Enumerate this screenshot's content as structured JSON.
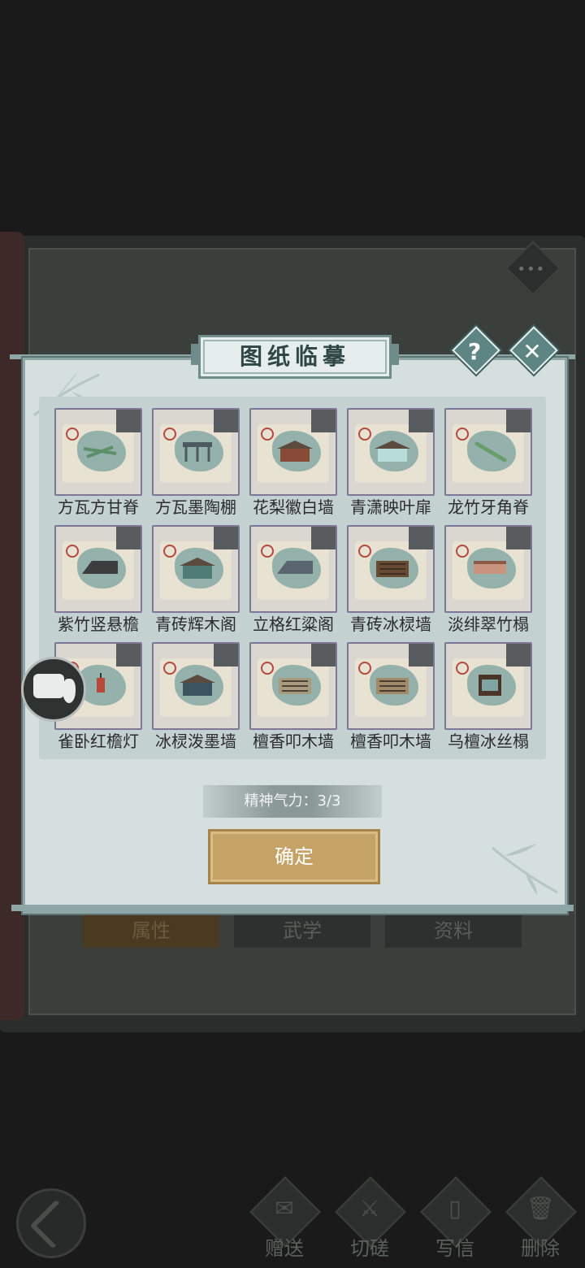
{
  "background": {
    "tabs": [
      "属性",
      "武学",
      "资料"
    ],
    "bottom_actions": [
      {
        "label": "赠送",
        "icon": "scroll-icon"
      },
      {
        "label": "切磋",
        "icon": "sword-icon"
      },
      {
        "label": "写信",
        "icon": "letter-icon"
      },
      {
        "label": "删除",
        "icon": "trash-icon"
      }
    ],
    "more_label": "•••"
  },
  "dialog": {
    "title": "图纸临摹",
    "help_label": "?",
    "close_label": "✕",
    "items": [
      {
        "name": "方瓦方甘脊",
        "color": "#5c8f6a",
        "shape": "beam"
      },
      {
        "name": "方瓦墨陶棚",
        "color": "#4d5a60",
        "shape": "pavilion"
      },
      {
        "name": "花梨徽白墙",
        "color": "#8a4a38",
        "shape": "house"
      },
      {
        "name": "青潇映叶扉",
        "color": "#b8ddd8",
        "shape": "house"
      },
      {
        "name": "龙竹牙角脊",
        "color": "#6a9d6e",
        "shape": "stick"
      },
      {
        "name": "紫竹竖悬檐",
        "color": "#3d3d3d",
        "shape": "roof"
      },
      {
        "name": "青砖辉木阁",
        "color": "#4f7c74",
        "shape": "house"
      },
      {
        "name": "立格红粱阁",
        "color": "#5b6570",
        "shape": "roof"
      },
      {
        "name": "青砖冰棂墙",
        "color": "#6a4a32",
        "shape": "wall"
      },
      {
        "name": "淡绯翠竹榻",
        "color": "#c9947d",
        "shape": "bed"
      },
      {
        "name": "雀卧红檐灯",
        "color": "#b8483a",
        "shape": "lamp"
      },
      {
        "name": "冰棂泼墨墙",
        "color": "#3a5560",
        "shape": "house"
      },
      {
        "name": "檀香叩木墙",
        "color": "#a89a7c",
        "shape": "wall"
      },
      {
        "name": "檀香叩木墙",
        "color": "#a1896a",
        "shape": "wall"
      },
      {
        "name": "乌檀冰丝榻",
        "color": "#4a3528",
        "shape": "canopy"
      }
    ],
    "energy_label": "精神气力：3/3",
    "confirm_label": "确定"
  }
}
